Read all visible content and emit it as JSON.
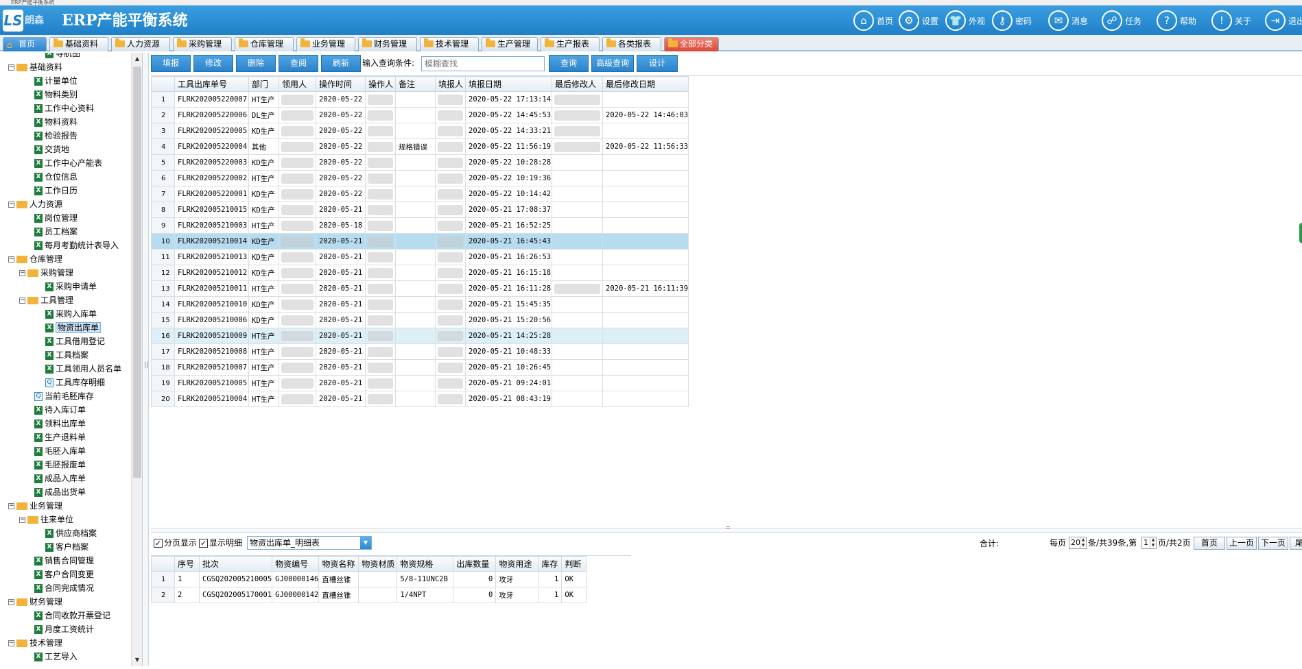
{
  "window_title": "ERP产能平衡系统",
  "header": {
    "logo_mark": "LS",
    "brand": "朗森",
    "title": "ERP产能平衡系统",
    "buttons": [
      {
        "icon": "home-icon",
        "glyph": "⌂",
        "label": "首页"
      },
      {
        "icon": "gear-icon",
        "glyph": "⚙",
        "label": "设置"
      },
      {
        "icon": "shirt-icon",
        "glyph": "👕",
        "label": "外观"
      },
      {
        "icon": "key-icon",
        "glyph": "⚷",
        "label": "密码"
      },
      {
        "icon": "mail-icon",
        "glyph": "✉",
        "label": "消息"
      },
      {
        "icon": "task-icon",
        "glyph": "☍",
        "label": "任务"
      },
      {
        "icon": "help-icon",
        "glyph": "?",
        "label": "帮助"
      },
      {
        "icon": "info-icon",
        "glyph": "!",
        "label": "关于"
      },
      {
        "icon": "exit-icon",
        "glyph": "⇥",
        "label": "退出"
      }
    ]
  },
  "tabs": [
    {
      "label": "首页",
      "state": "active",
      "icon": "home"
    },
    {
      "label": "基础资料",
      "state": "normal",
      "icon": "folder"
    },
    {
      "label": "人力资源",
      "state": "normal",
      "icon": "folder"
    },
    {
      "label": "采购管理",
      "state": "normal",
      "icon": "folder"
    },
    {
      "label": "仓库管理",
      "state": "normal",
      "icon": "folder"
    },
    {
      "label": "业务管理",
      "state": "normal",
      "icon": "folder"
    },
    {
      "label": "财务管理",
      "state": "normal",
      "icon": "folder"
    },
    {
      "label": "技术管理",
      "state": "normal",
      "icon": "folder"
    },
    {
      "label": "生产管理",
      "state": "normal",
      "icon": "folder"
    },
    {
      "label": "生产报表",
      "state": "normal",
      "icon": "folder"
    },
    {
      "label": "各类报表",
      "state": "normal",
      "icon": "folder"
    },
    {
      "label": "全部分类",
      "state": "red",
      "icon": "folder"
    }
  ],
  "tree": [
    {
      "label": "导航图",
      "level": 2,
      "type": "file",
      "selected": false
    },
    {
      "label": "基础资料",
      "level": 0,
      "type": "folder",
      "selected": false
    },
    {
      "label": "计量单位",
      "level": 1,
      "type": "file",
      "selected": false
    },
    {
      "label": "物料类别",
      "level": 1,
      "type": "file",
      "selected": false
    },
    {
      "label": "工作中心资料",
      "level": 1,
      "type": "file",
      "selected": false
    },
    {
      "label": "物料资料",
      "level": 1,
      "type": "file",
      "selected": false
    },
    {
      "label": "检验报告",
      "level": 1,
      "type": "file",
      "selected": false
    },
    {
      "label": "交货地",
      "level": 1,
      "type": "file",
      "selected": false
    },
    {
      "label": "工作中心产能表",
      "level": 1,
      "type": "file",
      "selected": false
    },
    {
      "label": "仓位信息",
      "level": 1,
      "type": "file",
      "selected": false
    },
    {
      "label": "工作日历",
      "level": 1,
      "type": "file",
      "selected": false
    },
    {
      "label": "人力资源",
      "level": 0,
      "type": "folder",
      "selected": false
    },
    {
      "label": "岗位管理",
      "level": 1,
      "type": "file",
      "selected": false
    },
    {
      "label": "员工档案",
      "level": 1,
      "type": "file",
      "selected": false
    },
    {
      "label": "每月考勤统计表导入",
      "level": 1,
      "type": "file",
      "selected": false
    },
    {
      "label": "仓库管理",
      "level": 0,
      "type": "folder",
      "selected": false
    },
    {
      "label": "采购管理",
      "level": 1,
      "type": "folder",
      "selected": false
    },
    {
      "label": "采购申请单",
      "level": 2,
      "type": "file",
      "selected": false
    },
    {
      "label": "工具管理",
      "level": 1,
      "type": "folder",
      "selected": false
    },
    {
      "label": "采购入库单",
      "level": 2,
      "type": "file",
      "selected": false
    },
    {
      "label": "物资出库单",
      "level": 2,
      "type": "file",
      "selected": true
    },
    {
      "label": "工具借用登记",
      "level": 2,
      "type": "file",
      "selected": false
    },
    {
      "label": "工具档案",
      "level": 2,
      "type": "file",
      "selected": false
    },
    {
      "label": "工具领用人员名单",
      "level": 2,
      "type": "file",
      "selected": false
    },
    {
      "label": "工具库存明细",
      "level": 2,
      "type": "query",
      "selected": false
    },
    {
      "label": "当前毛胚库存",
      "level": 1,
      "type": "query",
      "selected": false
    },
    {
      "label": "待入库订单",
      "level": 1,
      "type": "file",
      "selected": false
    },
    {
      "label": "领料出库单",
      "level": 1,
      "type": "file",
      "selected": false
    },
    {
      "label": "生产退料单",
      "level": 1,
      "type": "file",
      "selected": false
    },
    {
      "label": "毛胚入库单",
      "level": 1,
      "type": "file",
      "selected": false
    },
    {
      "label": "毛胚报废单",
      "level": 1,
      "type": "file",
      "selected": false
    },
    {
      "label": "成品入库单",
      "level": 1,
      "type": "file",
      "selected": false
    },
    {
      "label": "成品出货单",
      "level": 1,
      "type": "file",
      "selected": false
    },
    {
      "label": "业务管理",
      "level": 0,
      "type": "folder",
      "selected": false
    },
    {
      "label": "往来单位",
      "level": 1,
      "type": "folder",
      "selected": false
    },
    {
      "label": "供应商档案",
      "level": 2,
      "type": "file",
      "selected": false
    },
    {
      "label": "客户档案",
      "level": 2,
      "type": "file",
      "selected": false
    },
    {
      "label": "销售合同管理",
      "level": 1,
      "type": "file",
      "selected": false
    },
    {
      "label": "客户合同变更",
      "level": 1,
      "type": "file",
      "selected": false
    },
    {
      "label": "合同完成情况",
      "level": 1,
      "type": "file",
      "selected": false
    },
    {
      "label": "财务管理",
      "level": 0,
      "type": "folder",
      "selected": false
    },
    {
      "label": "合同收款开票登记",
      "level": 1,
      "type": "file",
      "selected": false
    },
    {
      "label": "月度工资统计",
      "level": 1,
      "type": "file",
      "selected": false
    },
    {
      "label": "技术管理",
      "level": 0,
      "type": "folder",
      "selected": false
    },
    {
      "label": "工艺导入",
      "level": 1,
      "type": "file",
      "selected": false
    }
  ],
  "toolbar": {
    "buttons": [
      "填报",
      "修改",
      "删除",
      "查阅",
      "刷新"
    ],
    "query_label": "输入查询条件:",
    "query_placeholder": "模糊查找",
    "right_buttons": [
      "查询",
      "高级查询",
      "设计"
    ]
  },
  "main_table": {
    "columns": [
      "",
      "工具出库单号",
      "部门",
      "领用人",
      "操作时间",
      "操作人",
      "备注",
      "填报人",
      "填报日期",
      "最后修改人",
      "最后修改日期"
    ],
    "rows": [
      {
        "n": "1",
        "no": "FLRK202005220007",
        "dept": "HT生产",
        "user": "",
        "time": "2020-05-22",
        "op": "",
        "note": "",
        "filler": "",
        "fdate": "2020-05-22 17:13:14",
        "mod": "",
        "mdate": ""
      },
      {
        "n": "2",
        "no": "FLRK202005220006",
        "dept": "DL生产",
        "user": "",
        "time": "2020-05-22",
        "op": "",
        "note": "",
        "filler": "",
        "fdate": "2020-05-22 14:45:53",
        "mod": "",
        "mdate": "2020-05-22 14:46:03"
      },
      {
        "n": "3",
        "no": "FLRK202005220005",
        "dept": "KD生产",
        "user": "",
        "time": "2020-05-22",
        "op": "",
        "note": "",
        "filler": "",
        "fdate": "2020-05-22 14:33:21",
        "mod": "",
        "mdate": ""
      },
      {
        "n": "4",
        "no": "FLRK202005220004",
        "dept": "其他",
        "user": "",
        "time": "2020-05-22",
        "op": "",
        "note": "规格错误",
        "filler": "",
        "fdate": "2020-05-22 11:56:19",
        "mod": "",
        "mdate": "2020-05-22 11:56:33"
      },
      {
        "n": "5",
        "no": "FLRK202005220003",
        "dept": "KD生产",
        "user": "",
        "time": "2020-05-22",
        "op": "",
        "note": "",
        "filler": "",
        "fdate": "2020-05-22 10:28:28",
        "mod": "",
        "mdate": ""
      },
      {
        "n": "6",
        "no": "FLRK202005220002",
        "dept": "HT生产",
        "user": "",
        "time": "2020-05-22",
        "op": "",
        "note": "",
        "filler": "",
        "fdate": "2020-05-22 10:19:36",
        "mod": "",
        "mdate": ""
      },
      {
        "n": "7",
        "no": "FLRK202005220001",
        "dept": "KD生产",
        "user": "",
        "time": "2020-05-22",
        "op": "",
        "note": "",
        "filler": "",
        "fdate": "2020-05-22 10:14:42",
        "mod": "",
        "mdate": ""
      },
      {
        "n": "8",
        "no": "FLRK202005210015",
        "dept": "KD生产",
        "user": "",
        "time": "2020-05-21",
        "op": "",
        "note": "",
        "filler": "",
        "fdate": "2020-05-21 17:08:37",
        "mod": "",
        "mdate": ""
      },
      {
        "n": "9",
        "no": "FLRK202005210003",
        "dept": "HT生产",
        "user": "",
        "time": "2020-05-18",
        "op": "",
        "note": "",
        "filler": "",
        "fdate": "2020-05-21 16:52:25",
        "mod": "",
        "mdate": ""
      },
      {
        "n": "10",
        "no": "FLRK202005210014",
        "dept": "KD生产",
        "user": "",
        "time": "2020-05-21",
        "op": "",
        "note": "",
        "filler": "",
        "fdate": "2020-05-21 16:45:43",
        "mod": "",
        "mdate": ""
      },
      {
        "n": "11",
        "no": "FLRK202005210013",
        "dept": "KD生产",
        "user": "",
        "time": "2020-05-21",
        "op": "",
        "note": "",
        "filler": "",
        "fdate": "2020-05-21 16:26:53",
        "mod": "",
        "mdate": ""
      },
      {
        "n": "12",
        "no": "FLRK202005210012",
        "dept": "KD生产",
        "user": "",
        "time": "2020-05-21",
        "op": "",
        "note": "",
        "filler": "",
        "fdate": "2020-05-21 16:15:18",
        "mod": "",
        "mdate": ""
      },
      {
        "n": "13",
        "no": "FLRK202005210011",
        "dept": "HT生产",
        "user": "",
        "time": "2020-05-21",
        "op": "",
        "note": "",
        "filler": "",
        "fdate": "2020-05-21 16:11:28",
        "mod": "",
        "mdate": "2020-05-21 16:11:39"
      },
      {
        "n": "14",
        "no": "FLRK202005210010",
        "dept": "KD生产",
        "user": "",
        "time": "2020-05-21",
        "op": "",
        "note": "",
        "filler": "",
        "fdate": "2020-05-21 15:45:35",
        "mod": "",
        "mdate": ""
      },
      {
        "n": "15",
        "no": "FLRK202005210006",
        "dept": "KD生产",
        "user": "",
        "time": "2020-05-21",
        "op": "",
        "note": "",
        "filler": "",
        "fdate": "2020-05-21 15:20:56",
        "mod": "",
        "mdate": ""
      },
      {
        "n": "16",
        "no": "FLRK202005210009",
        "dept": "HT生产",
        "user": "",
        "time": "2020-05-21",
        "op": "",
        "note": "",
        "filler": "",
        "fdate": "2020-05-21 14:25:28",
        "mod": "",
        "mdate": ""
      },
      {
        "n": "17",
        "no": "FLRK202005210008",
        "dept": "HT生产",
        "user": "",
        "time": "2020-05-21",
        "op": "",
        "note": "",
        "filler": "",
        "fdate": "2020-05-21 10:48:33",
        "mod": "",
        "mdate": ""
      },
      {
        "n": "18",
        "no": "FLRK202005210007",
        "dept": "HT生产",
        "user": "",
        "time": "2020-05-21",
        "op": "",
        "note": "",
        "filler": "",
        "fdate": "2020-05-21 10:26:45",
        "mod": "",
        "mdate": ""
      },
      {
        "n": "19",
        "no": "FLRK202005210005",
        "dept": "HT生产",
        "user": "",
        "time": "2020-05-21",
        "op": "",
        "note": "",
        "filler": "",
        "fdate": "2020-05-21 09:24:01",
        "mod": "",
        "mdate": ""
      },
      {
        "n": "20",
        "no": "FLRK202005210004",
        "dept": "HT生产",
        "user": "",
        "time": "2020-05-21",
        "op": "",
        "note": "",
        "filler": "",
        "fdate": "2020-05-21 08:43:19",
        "mod": "",
        "mdate": ""
      }
    ]
  },
  "detail_bar": {
    "paged_label": "分页显示",
    "show_detail_label": "显示明细",
    "detail_select": "物资出库单_明细表",
    "total_label": "合计:",
    "per_page_prefix": "每页",
    "per_page": "20",
    "count_text": "条/共39条,第",
    "page": "1",
    "page_of_text": "页/共2页",
    "nav": [
      "首页",
      "上一页",
      "下一页",
      "尾页"
    ]
  },
  "detail_table": {
    "columns": [
      "",
      "序号",
      "批次",
      "物资编号",
      "物资名称",
      "物资材质",
      "物资规格",
      "出库数量",
      "物资用途",
      "库存",
      "判断"
    ],
    "rows": [
      {
        "n": "1",
        "seq": "1",
        "batch": "CGSQ202005210005",
        "code": "GJ00000146",
        "name": "直槽丝锥",
        "mat": "",
        "spec": "5/8-11UNC2B",
        "qty": "0",
        "use": "攻牙",
        "stock": "1",
        "judge": "OK"
      },
      {
        "n": "2",
        "seq": "2",
        "batch": "CGSQ202005170001",
        "code": "GJ00000142",
        "name": "直槽丝锥",
        "mat": "",
        "spec": "1/4NPT",
        "qty": "0",
        "use": "攻牙",
        "stock": "1",
        "judge": "OK"
      }
    ]
  }
}
